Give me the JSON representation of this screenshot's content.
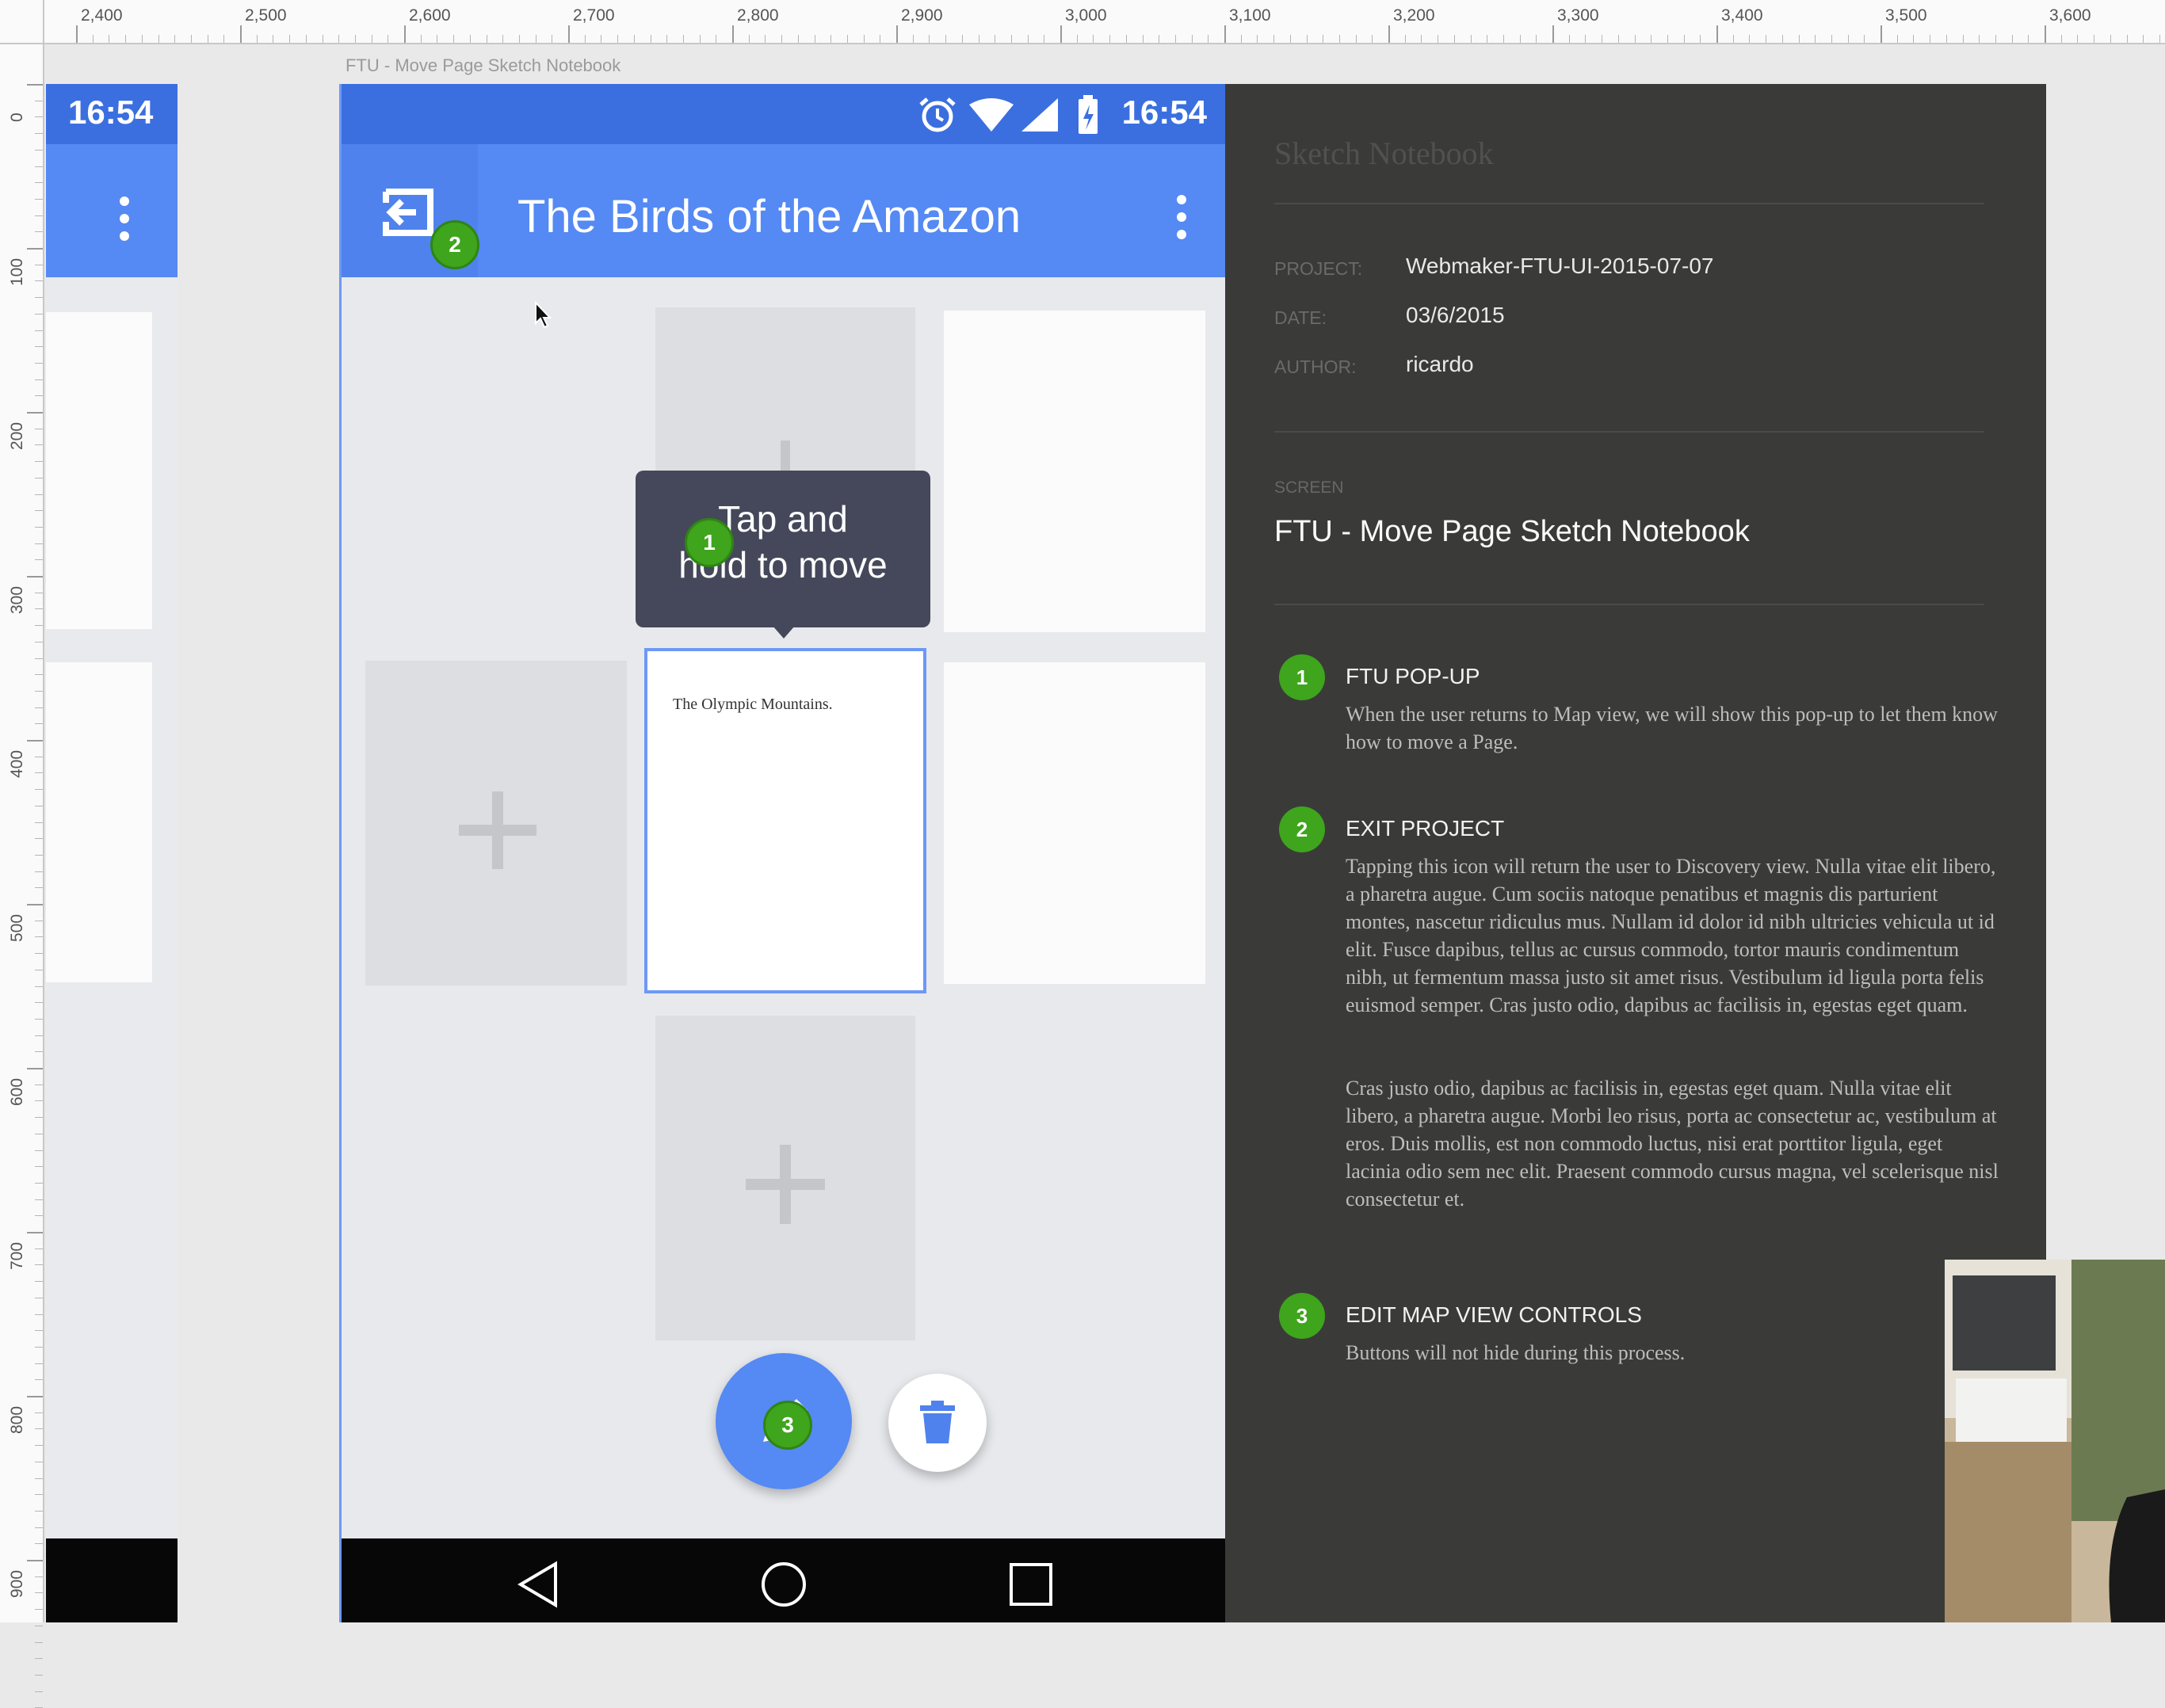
{
  "ruler": {
    "top_labels": [
      "2,400",
      "2,500",
      "2,600",
      "2,700",
      "2,800",
      "2,900",
      "3,000",
      "3,100",
      "3,200",
      "3,300",
      "3,400",
      "3,500",
      "3,600"
    ],
    "left_labels": [
      "0",
      "100",
      "200",
      "300",
      "400",
      "500",
      "600",
      "700",
      "800",
      "900"
    ]
  },
  "artboard_title": "FTU - Move Page Sketch Notebook",
  "left_phone": {
    "time": "16:54"
  },
  "phone": {
    "time": "16:54",
    "app_title": "The Birds of the Amazon",
    "tooltip": {
      "line1": "Tap and",
      "line2": "hold to move"
    },
    "selected_page_title": "The Olympic Mountains.",
    "badges": {
      "tooltip": "1",
      "exit": "2",
      "edit": "3"
    },
    "colors": {
      "status_bar": "#3b6fe0",
      "app_bar": "#5589f3",
      "accent": "#6d98f6",
      "badge": "#3ea51c"
    }
  },
  "notebook": {
    "title": "Sketch Notebook",
    "meta": [
      {
        "key": "PROJECT:",
        "value": "Webmaker-FTU-UI-2015-07-07"
      },
      {
        "key": "DATE:",
        "value": "03/6/2015"
      },
      {
        "key": "AUTHOR:",
        "value": "ricardo"
      }
    ],
    "screen_label": "SCREEN",
    "screen_name": "FTU - Move Page Sketch Notebook",
    "notes": [
      {
        "number": "1",
        "heading": "FTU POP-UP",
        "body": "When the user returns to Map view, we will show this pop-up to let them know how to move a Page."
      },
      {
        "number": "2",
        "heading": "EXIT PROJECT",
        "body": "Tapping this icon will return the user to Discovery view. Nulla vitae elit libero, a pharetra augue. Cum sociis natoque penatibus et magnis dis parturient montes, nascetur ridiculus mus. Nullam id dolor id nibh ultricies vehicula ut id elit. Fusce dapibus, tellus ac cursus commodo, tortor mauris condimentum nibh, ut fermentum massa justo sit amet risus. Vestibulum id ligula porta felis euismod semper. Cras justo odio, dapibus ac facilisis in, egestas eget quam.",
        "body2": "Cras justo odio, dapibus ac facilisis in, egestas eget quam. Nulla vitae elit libero, a pharetra augue. Morbi leo risus, porta ac consectetur ac, vestibulum at eros. Duis mollis, est non commodo luctus, nisi erat porttitor ligula, eget lacinia odio sem nec elit. Praesent commodo cursus magna, vel scelerisque nisl consectetur et."
      },
      {
        "number": "3",
        "heading": "EDIT MAP VIEW CONTROLS",
        "body": "Buttons will not hide during this process."
      }
    ]
  }
}
